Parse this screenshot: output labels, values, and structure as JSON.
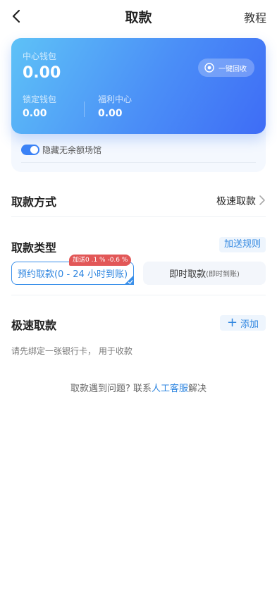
{
  "header": {
    "title": "取款",
    "right_link": "教程"
  },
  "wallet": {
    "center_label": "中心钱包",
    "center_value": "0.00",
    "recover_label": "一键回收",
    "locked_label": "锁定钱包",
    "locked_value": "0.00",
    "welfare_label": "福利中心",
    "welfare_value": "0.00",
    "hide_label": "隐藏无余额场馆",
    "hide_enabled": true
  },
  "withdraw_method": {
    "title": "取款方式",
    "value": "极速取款"
  },
  "withdraw_type": {
    "title": "取款类型",
    "rules_label": "加送规则",
    "bonus_badge": "加送0 .1 % -0.6 %",
    "options": [
      {
        "label": "预约取款(0 - 24 小时到账)",
        "selected": true
      },
      {
        "label": "即时取款",
        "sub": "(即时到账)",
        "selected": false
      }
    ]
  },
  "fast_withdraw": {
    "title": "极速取款",
    "add_label": "添加",
    "hint": "请先绑定一张银行卡， 用于收款"
  },
  "help": {
    "prefix": "取款遇到问题?  联系",
    "link": "人工客服",
    "suffix": "解决"
  },
  "colors": {
    "accent": "#2f86e0",
    "badge": "#e25757",
    "card_start": "#5ec2f7",
    "card_end": "#3e6cf6"
  }
}
